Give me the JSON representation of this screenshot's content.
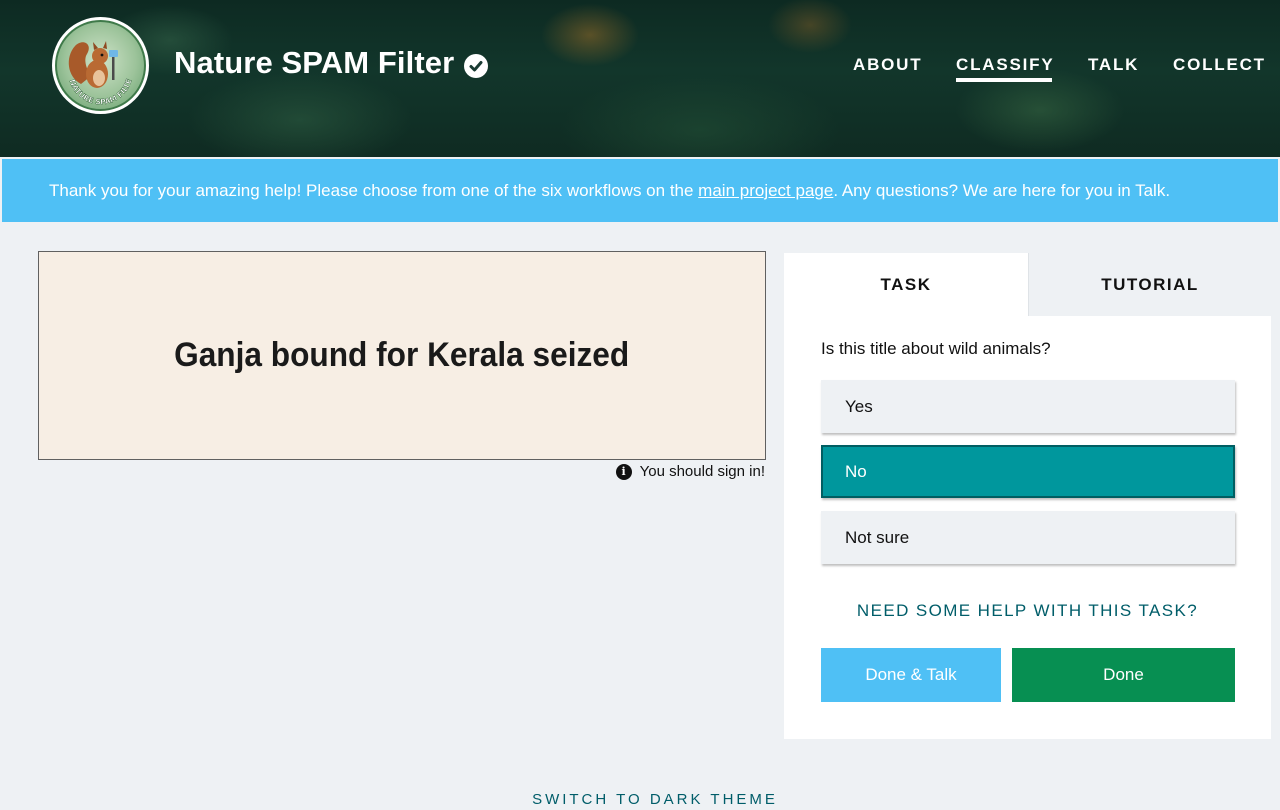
{
  "header": {
    "project_title": "Nature SPAM Filter",
    "logo_text": "NATURE SPAM FILTER",
    "verified_icon": "check-circle-icon",
    "nav": [
      {
        "label": "ABOUT",
        "active": false
      },
      {
        "label": "CLASSIFY",
        "active": true
      },
      {
        "label": "TALK",
        "active": false
      },
      {
        "label": "COLLECT",
        "active": false
      }
    ]
  },
  "banner": {
    "text_before": "Thank you for your amazing help! Please choose from one of the six workflows on the ",
    "link_text": "main project page",
    "text_after": ". Any questions? We are here for you in Talk."
  },
  "subject": {
    "headline": "Ganja bound for Kerala seized",
    "signin_notice": "You should sign in!",
    "info_icon": "info-icon"
  },
  "task_panel": {
    "tabs": [
      "TASK",
      "TUTORIAL"
    ],
    "active_tab": "TASK",
    "question": "Is this title about wild animals?",
    "answers": [
      {
        "label": "Yes",
        "selected": false
      },
      {
        "label": "No",
        "selected": true
      },
      {
        "label": "Not sure",
        "selected": false
      }
    ],
    "help_link": "NEED SOME HELP WITH THIS TASK?",
    "done_talk_label": "Done & Talk",
    "done_label": "Done"
  },
  "footer": {
    "theme_switch": "SWITCH TO DARK THEME"
  },
  "colors": {
    "banner": "#4fc0f5",
    "selected_answer": "#00979d",
    "done_button": "#078f52",
    "done_talk_button": "#4fc0f5",
    "link_teal": "#005d69"
  }
}
